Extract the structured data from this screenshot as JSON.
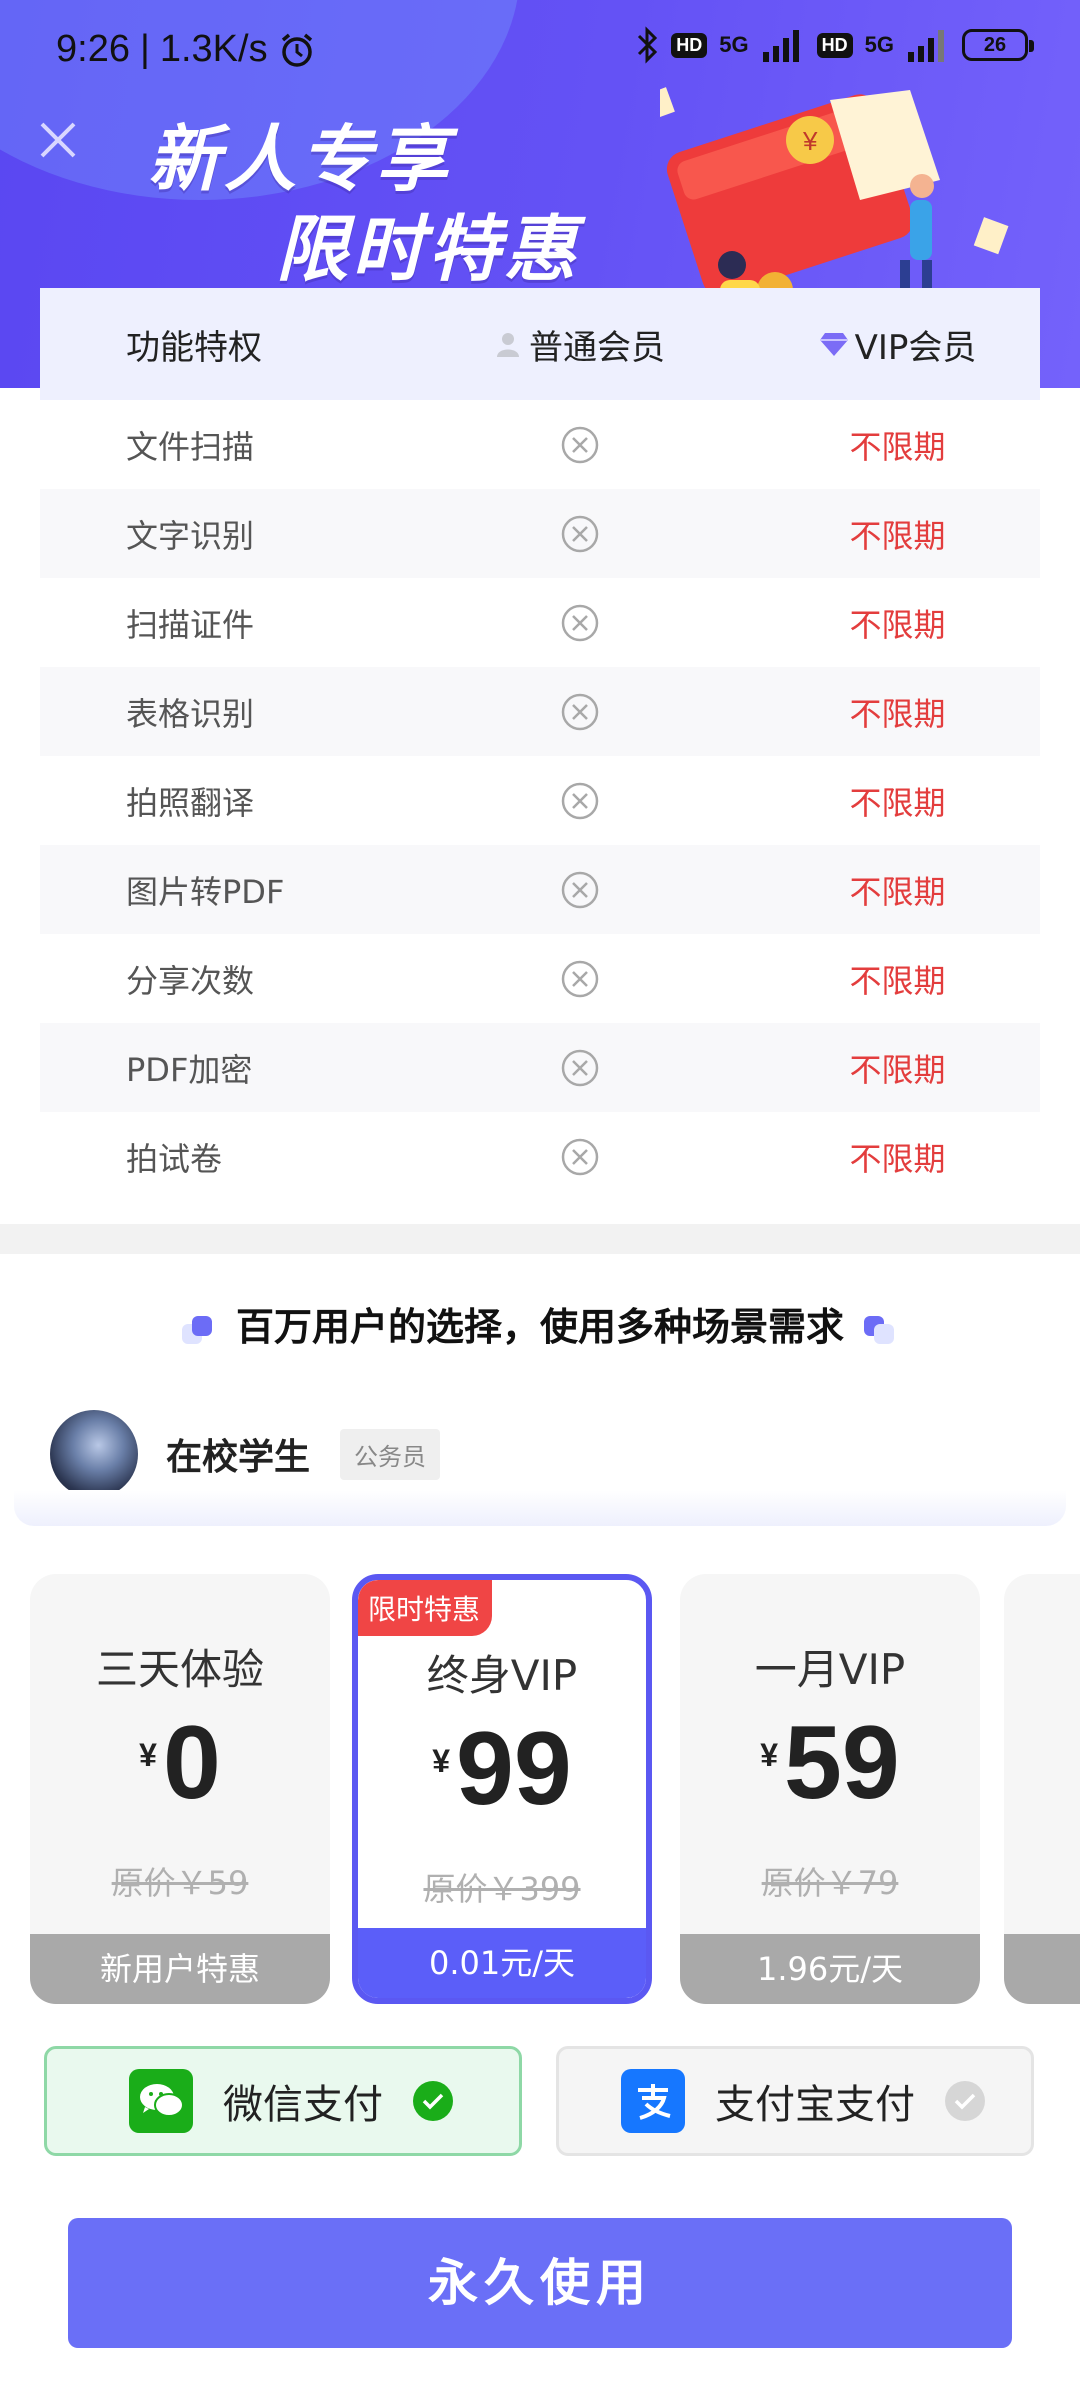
{
  "status_bar": {
    "time": "9:26",
    "speed": "1.3K/s",
    "network1": "5G",
    "network2": "5G",
    "hd_label": "HD",
    "battery": "26"
  },
  "promo": {
    "line1": "新人专享",
    "line2": "限时特惠"
  },
  "table": {
    "headers": {
      "feature": "功能特权",
      "normal": "普通会员",
      "vip": "VIP会员"
    },
    "rows": [
      {
        "feature": "文件扫描",
        "vip": "不限期"
      },
      {
        "feature": "文字识别",
        "vip": "不限期"
      },
      {
        "feature": "扫描证件",
        "vip": "不限期"
      },
      {
        "feature": "表格识别",
        "vip": "不限期"
      },
      {
        "feature": "拍照翻译",
        "vip": "不限期"
      },
      {
        "feature": "图片转PDF",
        "vip": "不限期"
      },
      {
        "feature": "分享次数",
        "vip": "不限期"
      },
      {
        "feature": "PDF加密",
        "vip": "不限期"
      },
      {
        "feature": "拍试卷",
        "vip": "不限期"
      }
    ]
  },
  "users_section": {
    "title": "百万用户的选择，使用多种场景需求",
    "user_name": "在校学生",
    "user_tag": "公务员"
  },
  "plans": [
    {
      "name": "三天体验",
      "currency": "¥",
      "price": "0",
      "original": "原价￥59",
      "footer": "新用户特惠",
      "selected": false
    },
    {
      "name": "终身VIP",
      "currency": "¥",
      "price": "99",
      "original": "原价￥399",
      "footer": "0.01元/天",
      "ribbon": "限时特惠",
      "selected": true
    },
    {
      "name": "一月VIP",
      "currency": "¥",
      "price": "59",
      "original": "原价￥79",
      "footer": "1.96元/天",
      "selected": false
    }
  ],
  "payment": {
    "wechat": {
      "label": "微信支付",
      "selected": true
    },
    "alipay": {
      "label": "支付宝支付",
      "selected": false
    }
  },
  "buy_button": "永久使用",
  "colors": {
    "brand": "#5b58f2",
    "vip_red": "#e33d3d",
    "wechat_green": "#1aad19",
    "alipay_blue": "#1677ff"
  }
}
